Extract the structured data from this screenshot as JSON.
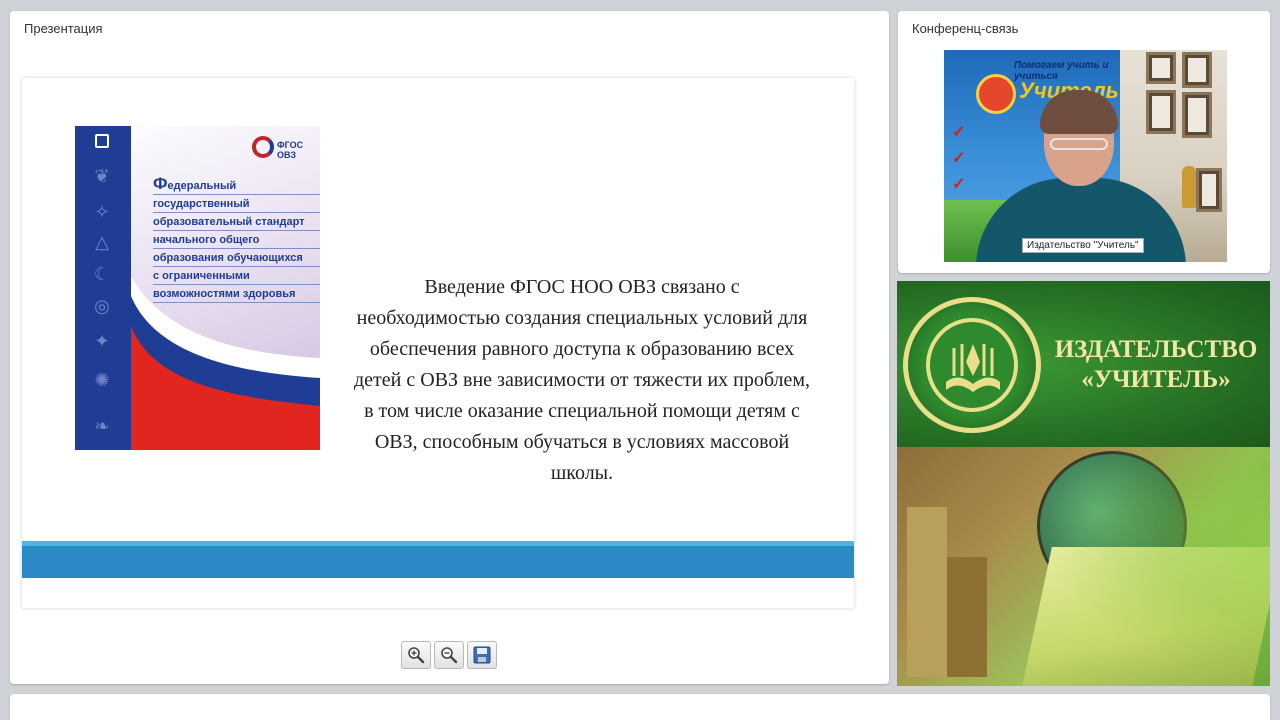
{
  "presentation_panel": {
    "title": "Презентация",
    "slide": {
      "body_text": "Введение ФГОС НОО ОВЗ связано с необходимостью создания специальных условий для обеспечения равного доступа к образованию всех детей с ОВЗ вне зависимости от тяжести их проблем, в том числе оказание специальной помощи детям с ОВЗ, способным обучаться в условиях массовой школы.",
      "cover": {
        "logo_line1": "ФГОС",
        "logo_line2": "ОВЗ",
        "title_lines": [
          "Федеральный",
          "государственный",
          "образовательный стандарт",
          "начального общего",
          "образования обучающихся",
          "с ограниченными",
          "возможностями здоровья"
        ]
      }
    },
    "toolbar": {
      "zoom_in_icon": "zoom-in-icon",
      "zoom_out_icon": "zoom-out-icon",
      "save_icon": "floppy-disk-icon"
    }
  },
  "conference_panel": {
    "title": "Конференц-связь",
    "video": {
      "participant_label": "Издательство \"Учитель\"",
      "banner_top": "Помогаем учить и учиться",
      "banner_title": "Учитель"
    }
  },
  "publisher_ad": {
    "line1": "ИЗДАТЕЛЬСТВО",
    "line2": "«УЧИТЕЛЬ»"
  },
  "colors": {
    "slide_band_light": "#4ab7e0",
    "slide_band_dark": "#2d88c6",
    "publisher_green": "#236a22",
    "publisher_text": "#f1e9a3"
  }
}
